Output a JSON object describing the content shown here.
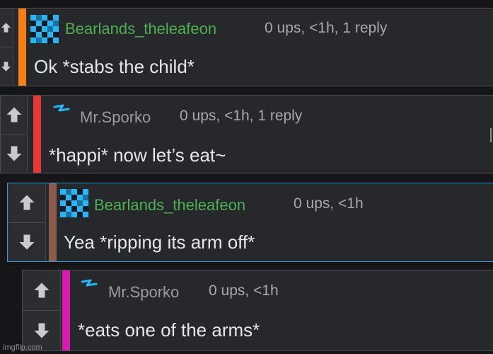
{
  "colors": {
    "accent_orange": "#f57f17",
    "accent_red": "#e53935",
    "accent_brown": "#8d5a4e",
    "accent_magenta": "#d81bb0",
    "user_green": "#4caf50",
    "user_gray": "#9a9ca0",
    "highlight_border": "#2e9ad6"
  },
  "comments": [
    {
      "username": "Bearlands_theleafeon",
      "meta": "0 ups, <1h, 1 reply",
      "text": "Ok *stabs the child*",
      "avatar_icon": "pixel-avatar-icon",
      "bar_color": "#f57f17"
    },
    {
      "username": "Mr.Sporko",
      "meta": "0 ups, <1h, 1 reply",
      "text": "*happi* now let’s eat~",
      "avatar_icon": "lightning-avatar-icon",
      "bar_color": "#e53935"
    },
    {
      "username": "Bearlands_theleafeon",
      "meta": "0 ups, <1h",
      "text": "Yea *ripping its arm off*",
      "avatar_icon": "pixel-avatar-icon",
      "bar_color": "#8d5a4e"
    },
    {
      "username": "Mr.Sporko",
      "meta": "0 ups, <1h",
      "text": "*eats one of the arms*",
      "avatar_icon": "lightning-avatar-icon",
      "bar_color": "#d81bb0"
    }
  ],
  "vote_icons": {
    "up": "upvote-arrow-icon",
    "down": "downvote-arrow-icon"
  },
  "watermark": "imgflip.com"
}
